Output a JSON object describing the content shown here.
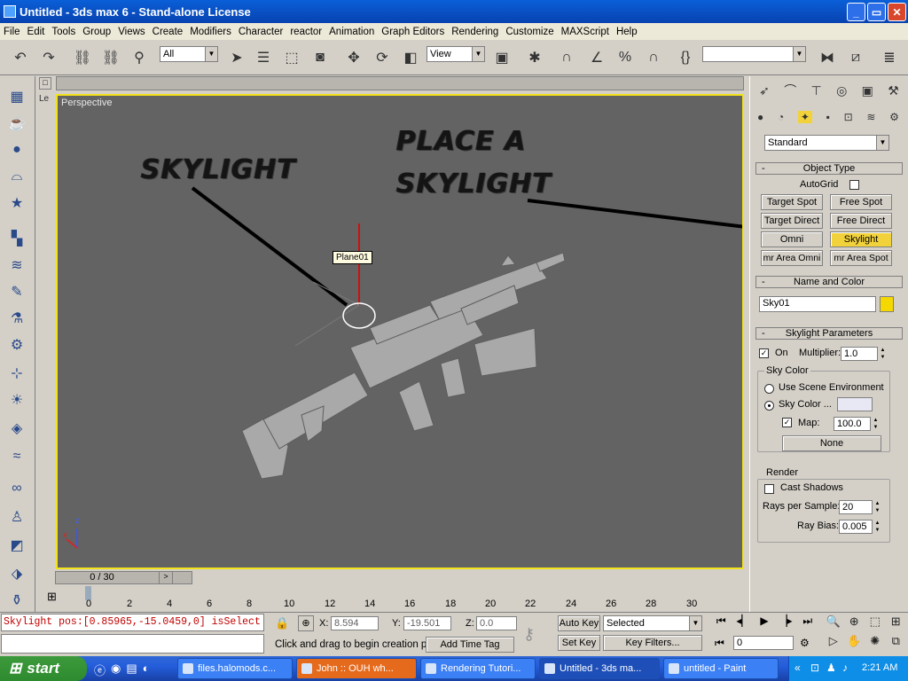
{
  "window": {
    "title": "Untitled - 3ds max 6 - Stand-alone License"
  },
  "menu": [
    "File",
    "Edit",
    "Tools",
    "Group",
    "Views",
    "Create",
    "Modifiers",
    "Character",
    "reactor",
    "Animation",
    "Graph Editors",
    "Rendering",
    "Customize",
    "MAXScript",
    "Help"
  ],
  "toolbar": {
    "selection_filter": "All",
    "ref_coord": "View",
    "named_selection": ""
  },
  "viewport": {
    "label": "Perspective",
    "left_tab": "Le",
    "object_label": "Plane01",
    "callout_1": "SKYLIGHT",
    "callout_2_line1": "PLACE A",
    "callout_2_line2": "SKYLIGHT",
    "axis_x": "x",
    "axis_z": "z"
  },
  "command_panel": {
    "category": "Standard",
    "object_type": {
      "title": "Object Type",
      "autogrid": "AutoGrid",
      "buttons": [
        "Target Spot",
        "Free Spot",
        "Target Direct",
        "Free Direct",
        "Omni",
        "Skylight",
        "mr Area Omni",
        "mr Area Spot"
      ],
      "active": "Skylight"
    },
    "name_color": {
      "title": "Name and Color",
      "name": "Sky01",
      "color": "#f5d800"
    },
    "skylight_params": {
      "title": "Skylight Parameters",
      "on_label": "On",
      "multiplier_label": "Multiplier:",
      "multiplier": "1.0",
      "sky_color_group": "Sky Color",
      "use_scene_env": "Use Scene Environment",
      "sky_color_label": "Sky Color ...",
      "sky_color_swatch": "#e8e8f4",
      "map_label": "Map:",
      "map_value": "100.0",
      "map_button": "None",
      "render_group": "Render",
      "cast_shadows": "Cast Shadows",
      "rays_label": "Rays per Sample:",
      "rays_value": "20",
      "raybias_label": "Ray Bias:",
      "raybias_value": "0.005"
    }
  },
  "timeline": {
    "frame": "0 / 30",
    "ticks": [
      "0",
      "2",
      "4",
      "6",
      "8",
      "10",
      "12",
      "14",
      "16",
      "18",
      "20",
      "22",
      "24",
      "26",
      "28",
      "30"
    ]
  },
  "status": {
    "script_output": "Skylight pos:[0.85965,-15.0459,0] isSelect",
    "x_label": "X:",
    "x": "8.594",
    "y_label": "Y:",
    "y": "-19.501",
    "z_label": "Z:",
    "z": "0.0",
    "prompt": "Click and drag to begin creation pro",
    "add_time_tag": "Add Time Tag",
    "auto_key": "Auto Key",
    "set_key": "Set Key",
    "key_mode": "Selected",
    "key_filters": "Key Filters...",
    "current_frame": "0"
  },
  "taskbar": {
    "start": "start",
    "tasks": [
      "files.halomods.c...",
      "John :: OUH wh...",
      "Rendering Tutori...",
      "Untitled - 3ds ma...",
      "untitled - Paint"
    ],
    "clock": "2:21 AM"
  }
}
